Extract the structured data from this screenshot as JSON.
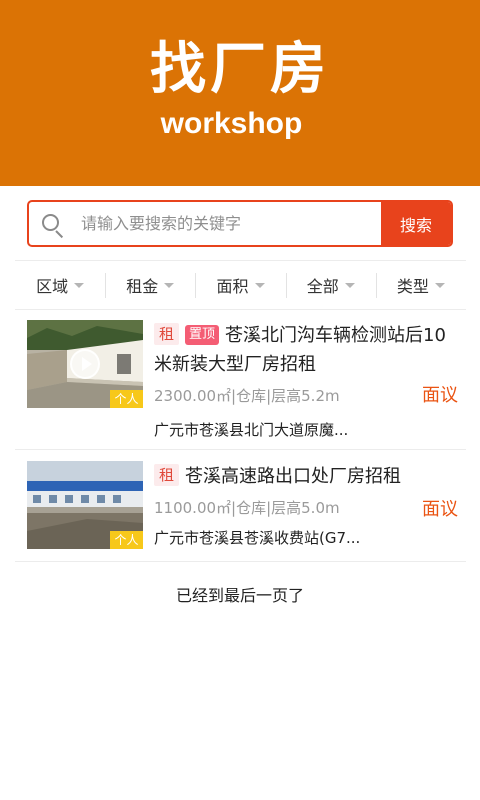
{
  "header": {
    "title": "找厂房",
    "subtitle": "workshop"
  },
  "search": {
    "placeholder": "请输入要搜索的关键字",
    "button_label": "搜索"
  },
  "filters": [
    {
      "label": "区域"
    },
    {
      "label": "租金"
    },
    {
      "label": "面积"
    },
    {
      "label": "全部"
    },
    {
      "label": "类型"
    }
  ],
  "listings": [
    {
      "tag": "租",
      "badge": "置顶",
      "title": "苍溪北门沟车辆检测站后10米新装大型厂房招租",
      "meta": "2300.00㎡|仓库|层高5.2m",
      "price": "面议",
      "address": "广元市苍溪县北门大道原魔...",
      "owner_type": "个人",
      "has_video": true
    },
    {
      "tag": "租",
      "title": "苍溪高速路出口处厂房招租",
      "meta": "1100.00㎡|仓库|层高5.0m",
      "price": "面议",
      "address": "广元市苍溪县苍溪收费站(G7...",
      "owner_type": "个人",
      "has_video": false
    }
  ],
  "end_note": "已经到最后一页了",
  "colors": {
    "header_bg": "#db7305",
    "accent": "#e8431c",
    "price": "#ea5413",
    "badge_top": "#f45d74",
    "owner_tag": "#f7c81a"
  },
  "icons": {
    "search": "search-icon",
    "play": "play-icon",
    "dropdown": "caret-down-icon"
  }
}
